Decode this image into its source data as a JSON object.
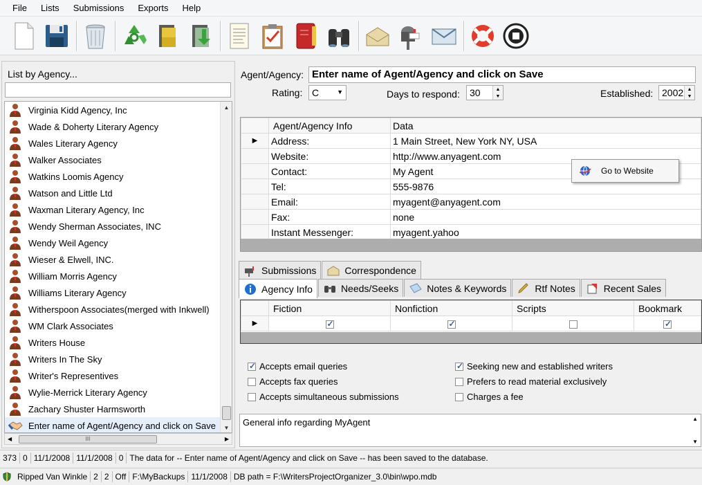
{
  "menu": [
    "File",
    "Lists",
    "Submissions",
    "Exports",
    "Help"
  ],
  "toolbar_icons": [
    "new-document-icon",
    "save-disk-icon",
    "trash-bin-icon",
    "recycle-icon",
    "folder-open-icon",
    "import-folder-icon",
    "notes-icon",
    "clipboard-check-icon",
    "address-book-icon",
    "binoculars-icon",
    "envelope-icon",
    "mailbox-icon",
    "mail-send-icon",
    "lifebuoy-help-icon",
    "stop-exit-icon"
  ],
  "left": {
    "title": "List by Agency...",
    "search_value": "",
    "agencies": [
      "Virginia Kidd Agency, Inc",
      "Wade & Doherty Literary Agency",
      "Wales Literary Agency",
      "Walker Associates",
      "Watkins Loomis Agency",
      "Watson and Little Ltd",
      "Waxman Literary Agency, Inc",
      "Wendy Sherman Associates, INC",
      "Wendy Weil Agency",
      "Wieser & Elwell, INC.",
      "William Morris Agency",
      "Williams Literary Agency",
      "Witherspoon Associates(merged with Inkwell)",
      "WM Clark Associates",
      "Writers House",
      "Writers In The Sky",
      "Writer's Representives",
      "Wylie-Merrick Literary Agency",
      "Zachary Shuster Harmsworth",
      "Enter name of Agent/Agency and click on Save"
    ],
    "hscroll_thumb": "III"
  },
  "form": {
    "agent_label": "Agent/Agency:",
    "agent_value": "Enter name of Agent/Agency and click on Save",
    "rating_label": "Rating:",
    "rating_value": "C",
    "days_label": "Days to respond:",
    "days_value": "30",
    "established_label": "Established:",
    "established_value": "2002"
  },
  "info_grid": {
    "headers": [
      "Agent/Agency Info",
      "Data"
    ],
    "rows": [
      [
        "Address:",
        "1 Main Street, New York NY, USA"
      ],
      [
        "Website:",
        "http://www.anyagent.com"
      ],
      [
        "Contact:",
        "My Agent"
      ],
      [
        "Tel:",
        "555-9876"
      ],
      [
        "Email:",
        "myagent@anyagent.com"
      ],
      [
        "Fax:",
        "none"
      ],
      [
        "Instant Messenger:",
        "myagent.yahoo"
      ]
    ]
  },
  "context_menu": {
    "item": "Go to Website"
  },
  "tabs_top": [
    "Submissions",
    "Correspondence"
  ],
  "tabs_bottom": [
    "Agency Info",
    "Needs/Seeks",
    "Notes & Keywords",
    "Rtf Notes",
    "Recent Sales"
  ],
  "genre_grid": {
    "headers": [
      "Fiction",
      "Nonfiction",
      "Scripts",
      "Bookmark"
    ],
    "checked": [
      true,
      true,
      false,
      true
    ]
  },
  "options_left": [
    {
      "label": "Accepts email queries",
      "checked": true
    },
    {
      "label": "Accepts fax queries",
      "checked": false
    },
    {
      "label": "Accepts simultaneous submissions",
      "checked": false
    }
  ],
  "options_right": [
    {
      "label": "Seeking new and established writers",
      "checked": true
    },
    {
      "label": "Prefers to read material exclusively",
      "checked": false
    },
    {
      "label": "Charges a fee",
      "checked": false
    }
  ],
  "general_info": "General info regarding MyAgent",
  "status1": [
    "373",
    "0",
    "11/1/2008",
    "11/1/2008",
    "0",
    "The data for -- Enter name of Agent/Agency and click on Save -- has been saved to the database."
  ],
  "status2": [
    "Ripped Van Winkle",
    "2",
    "2",
    "Off",
    "F:\\MyBackups",
    "11/1/2008",
    "DB path = F:\\WritersProjectOrganizer_3.0\\bin\\wpo.mdb"
  ]
}
